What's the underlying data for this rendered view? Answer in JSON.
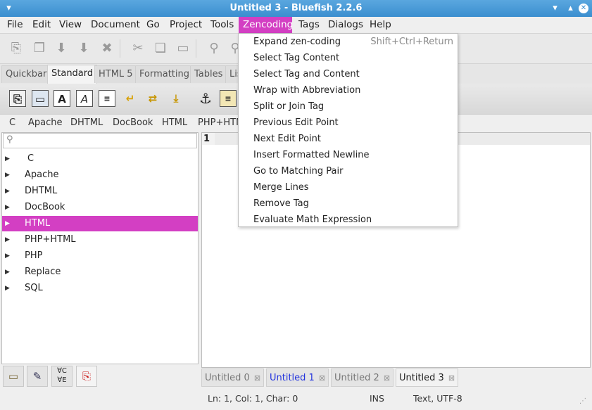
{
  "window": {
    "title": "Untitled 3 - Bluefish 2.2.6"
  },
  "menubar": [
    "File",
    "Edit",
    "View",
    "Document",
    "Go",
    "Project",
    "Tools",
    "Zencoding",
    "Tags",
    "Dialogs",
    "Help"
  ],
  "tabs": [
    "Quickbar",
    "Standard",
    "HTML 5",
    "Formatting",
    "Tables",
    "Lis"
  ],
  "plugin_menus": [
    "C",
    "Apache",
    "DHTML",
    "DocBook",
    "HTML",
    "PHP+HTM"
  ],
  "tree": [
    "C",
    "Apache",
    "DHTML",
    "DocBook",
    "HTML",
    "PHP+HTML",
    "PHP",
    "Replace",
    "SQL"
  ],
  "editor": {
    "line_number": "1"
  },
  "doc_tabs": [
    "Untitled 0",
    "Untitled 1",
    "Untitled 2",
    "Untitled 3"
  ],
  "status": {
    "position": "Ln: 1, Col: 1, Char: 0",
    "mode": "INS",
    "encoding": "Text, UTF-8"
  },
  "zencoding_menu": {
    "items": [
      "Expand zen-coding",
      "Select Tag Content",
      "Select Tag and Content",
      "Wrap with Abbreviation",
      "Split or Join Tag",
      "Previous Edit Point",
      "Next Edit Point",
      "Insert Formatted Newline",
      "Go to Matching Pair",
      "Merge Lines",
      "Remove Tag",
      "Evaluate Math Expression"
    ],
    "shortcut": "Shift+Ctrl+Return"
  },
  "colors": {
    "accent": "#d33fc3",
    "titlebar": "#3b8fcf"
  }
}
